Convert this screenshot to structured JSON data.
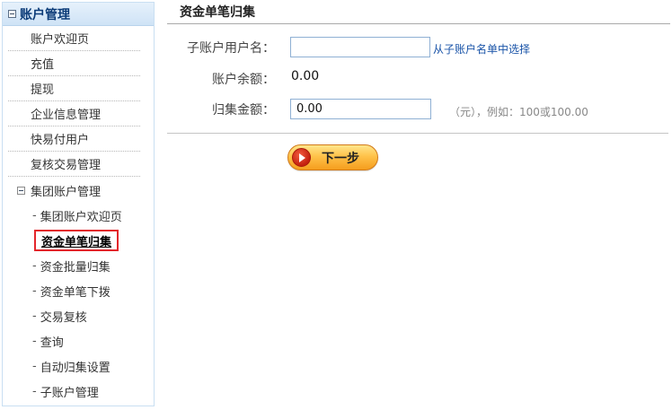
{
  "sidebar": {
    "header": "账户管理",
    "items": [
      "账户欢迎页",
      "充值",
      "提现",
      "企业信息管理",
      "快易付用户",
      "复核交易管理"
    ],
    "group": {
      "label": "集团账户管理",
      "items": [
        "集团账户欢迎页",
        "资金单笔归集",
        "资金批量归集",
        "资金单笔下拨",
        "交易复核",
        "查询",
        "自动归集设置",
        "子账户管理"
      ]
    }
  },
  "main": {
    "title": "资金单笔归集",
    "form": {
      "username_label": "子账户用户名：",
      "username_value": "",
      "select_link": "从子账户名单中选择",
      "balance_label": "账户余额：",
      "balance_value": "0.00",
      "amount_label": "归集金额：",
      "amount_value": "0.00",
      "amount_hint": "（元），例如：100或100.00"
    },
    "next_button": "下一步"
  }
}
